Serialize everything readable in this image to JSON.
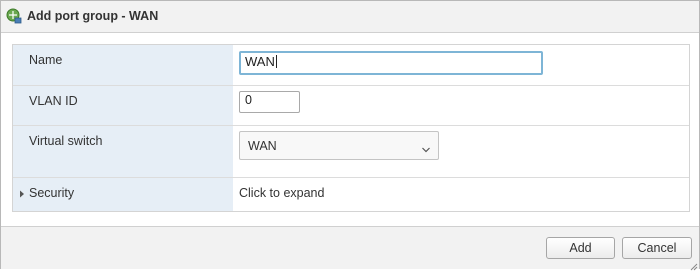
{
  "dialog": {
    "title": "Add port group - WAN",
    "icon": "port-group-network-icon"
  },
  "form": {
    "name": {
      "label": "Name",
      "value": "WAN"
    },
    "vlan_id": {
      "label": "VLAN ID",
      "value": "0"
    },
    "virtual_switch": {
      "label": "Virtual switch",
      "selected": "WAN"
    },
    "security": {
      "label": "Security",
      "action_text": "Click to expand"
    }
  },
  "buttons": {
    "add": "Add",
    "cancel": "Cancel"
  },
  "colors": {
    "label_background": "#e6eef6",
    "focus_border": "#7eb5d6",
    "titlebar_background": "#f2f2f2"
  }
}
